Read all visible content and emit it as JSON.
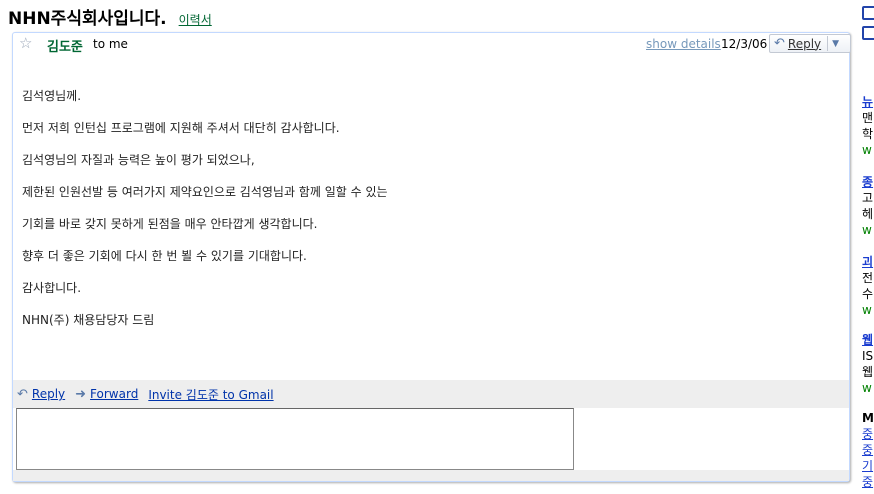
{
  "subject": "NHN주식회사입니다.",
  "label": "이력서",
  "message": {
    "sender": "김도준",
    "recipients": "to me",
    "show_details": "show details",
    "date": "12/3/06",
    "reply_label": "Reply",
    "body": [
      "김석영님께.",
      "먼저 저희 인턴십 프로그램에 지원해 주셔서 대단히 감사합니다.",
      "김석영님의 자질과 능력은 높이 평가 되었으나,",
      "제한된 인원선발 등 여러가지 제약요인으로 김석영님과 함께 일할 수 있는",
      "기회를 바로 갖지 못하게 된점을 매우 안타깝게 생각합니다.",
      "향후 더 좋은 기회에 다시 한 번 뵐 수 있기를 기대합니다.",
      "감사합니다.",
      "NHN(주) 채용담당자 드림"
    ]
  },
  "actions": {
    "reply": "Reply",
    "forward": "Forward",
    "invite": "Invite 김도준 to Gmail"
  },
  "reply_box": {
    "value": ""
  },
  "sidebar": {
    "ads": [
      {
        "title": "뉴",
        "lines": [
          "맨",
          "학"
        ],
        "url": "w"
      },
      {
        "title": "종",
        "lines": [
          "고",
          "헤"
        ],
        "url": "w"
      },
      {
        "title": "괴",
        "lines": [
          "전",
          "수"
        ],
        "url": "w"
      },
      {
        "title": "웹",
        "lines": [
          "IS",
          "웹"
        ],
        "url": "w"
      }
    ],
    "more_heading": "M",
    "more_links": [
      "중",
      "중",
      "기",
      "중"
    ]
  },
  "colors": {
    "sender": "#006633",
    "link": "#0033aa",
    "card_border": "#c3d9ff",
    "action_bar": "#eeeeee"
  }
}
